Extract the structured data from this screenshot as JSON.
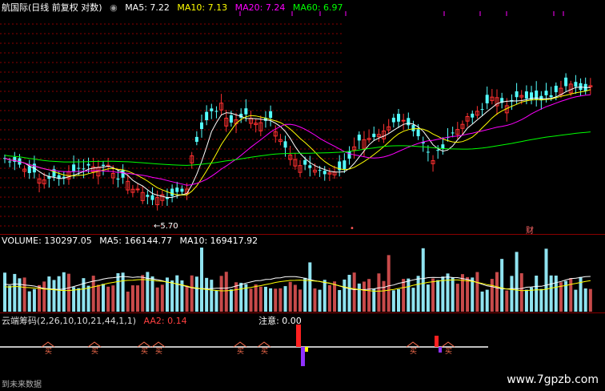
{
  "price_panel": {
    "title": "航国际(日线 前复权 对数)",
    "ma5": "MA5: 7.22",
    "ma10": "MA10: 7.13",
    "ma20": "MA20: 7.24",
    "ma60": "MA60: 6.97",
    "low_marker": "5.70",
    "event_tag_1": "•",
    "event_tag_2": "财"
  },
  "volume_panel": {
    "volume": "VOLUME: 130297.05",
    "ma5": "MA5: 166144.77",
    "ma10": "MA10: 169417.92"
  },
  "indicator_panel": {
    "name": "云端筹码(2,26,10,10,21,44,1,1)",
    "aa2": "AA2: 0.14",
    "notice": "注意: 0.00",
    "footer": "到未来数据",
    "marker_char": "买"
  },
  "watermark": "www.7gpzb.com",
  "colors": {
    "up": "#ff3030",
    "down": "#54ffff",
    "ma5": "#ffffff",
    "ma10": "#ffff00",
    "ma20": "#ff00ff",
    "ma60": "#00ff00",
    "grid": "#8b0000"
  }
}
